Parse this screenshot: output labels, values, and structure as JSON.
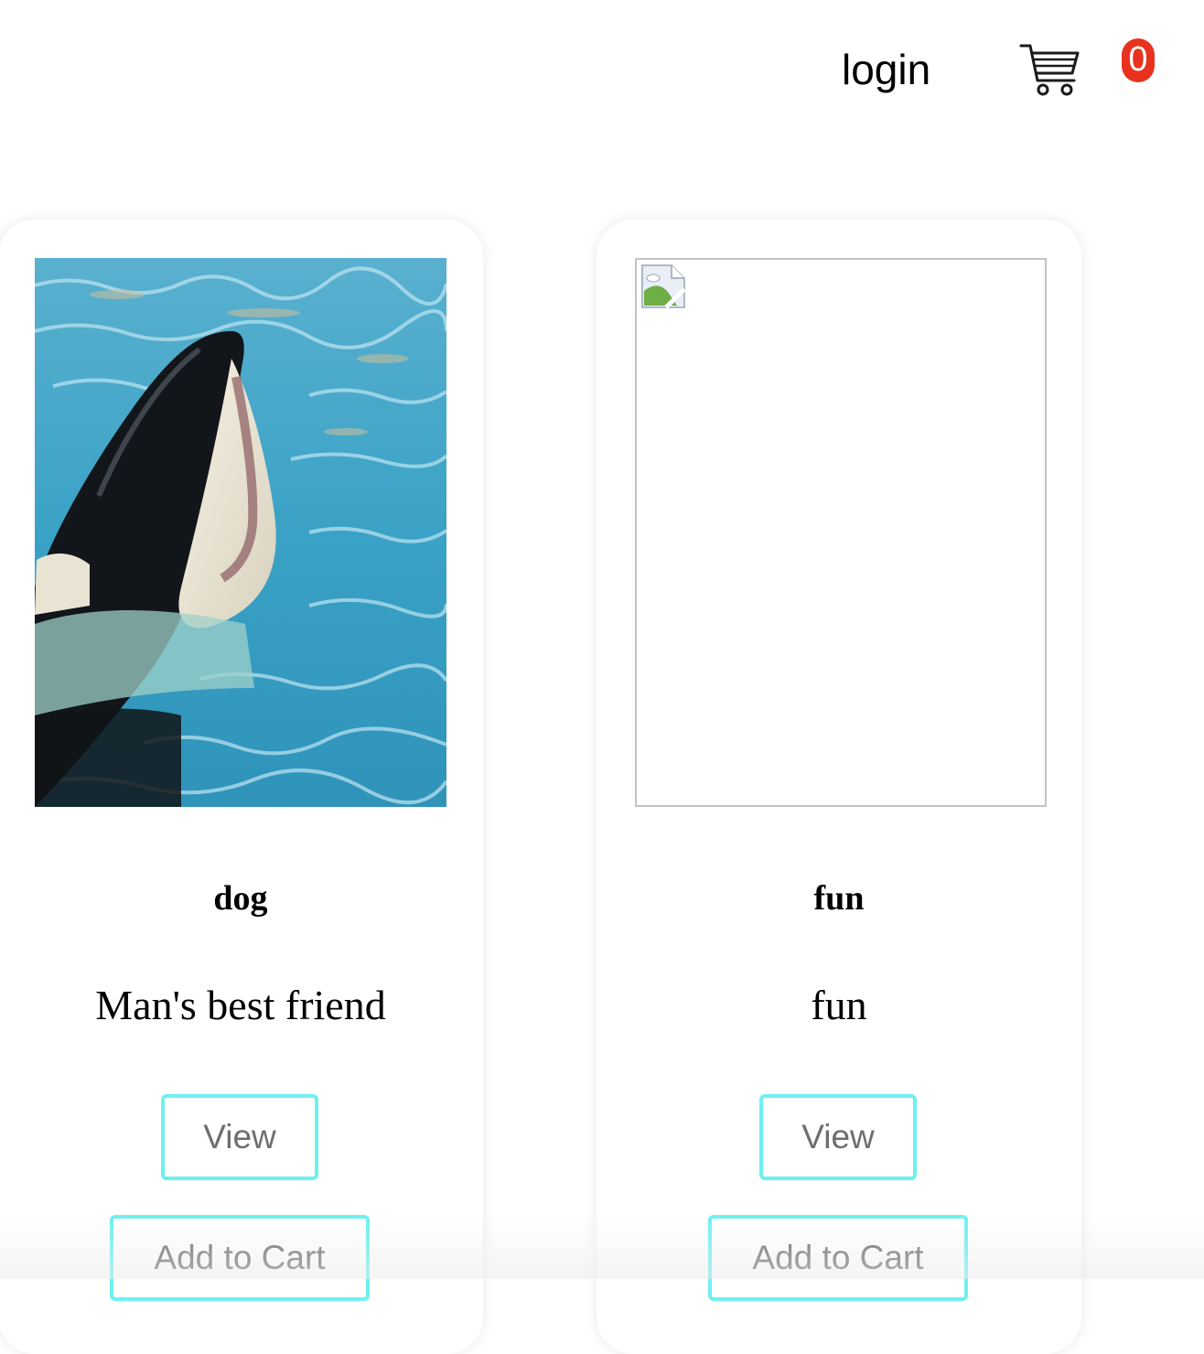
{
  "header": {
    "login_label": "login",
    "cart_icon": "shopping-cart-icon",
    "cart_count": "0",
    "badge_color": "#e8321e"
  },
  "products": [
    {
      "title": "dog",
      "description": "Man's best friend",
      "image": "orca-photo",
      "view_label": "View",
      "add_label": "Add to Cart"
    },
    {
      "title": "fun",
      "description": "fun",
      "image": "broken-image-icon",
      "view_label": "View",
      "add_label": "Add to Cart"
    }
  ],
  "colors": {
    "button_border": "#6ff0f0",
    "button_text": "#6e6e6e"
  }
}
